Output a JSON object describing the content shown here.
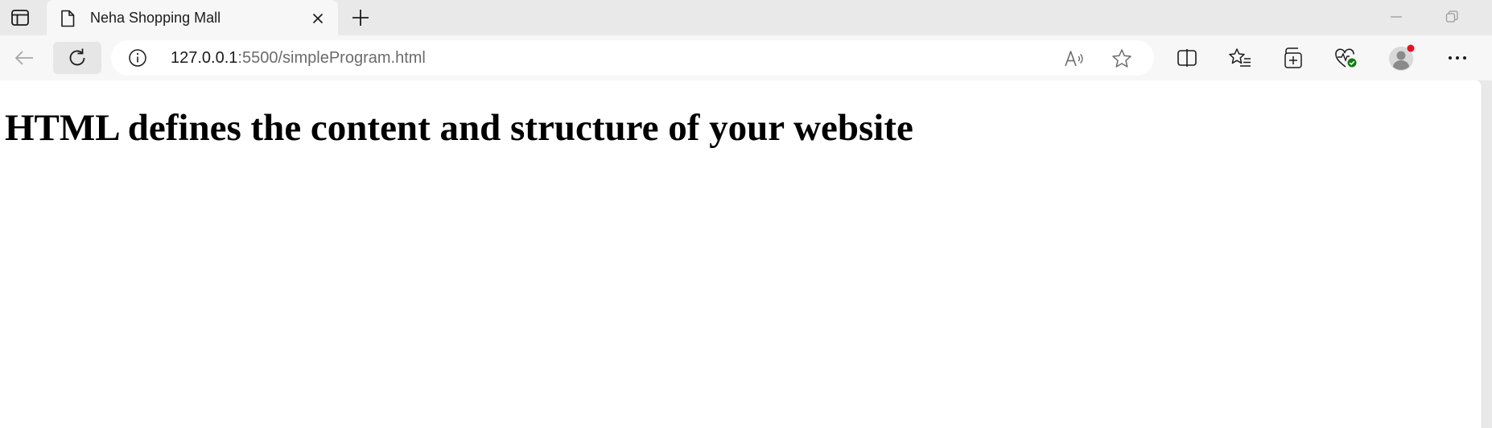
{
  "browser": {
    "tab": {
      "title": "Neha Shopping Mall"
    },
    "address": {
      "host": "127.0.0.1",
      "rest": ":5500/simpleProgram.html"
    },
    "icons": {
      "profile_badge_color": "#e81123",
      "health_badge_color": "#107c10"
    }
  },
  "page": {
    "heading": "HTML defines the content and structure of your website"
  }
}
